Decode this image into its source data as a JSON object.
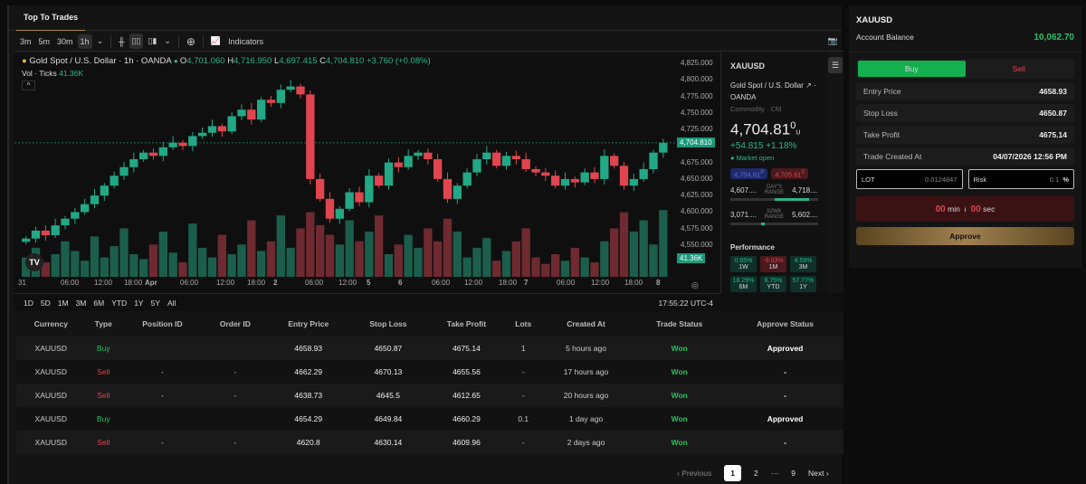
{
  "tab": "Top To Trades",
  "toolbar": {
    "intervals": [
      "3m",
      "5m",
      "30m",
      "1h"
    ],
    "indicators": "Indicators"
  },
  "symbol_line": {
    "title": "Gold Spot / U.S. Dollar · 1h · OANDA",
    "o": "4,701.060",
    "h": "4,716.950",
    "l": "4,697.415",
    "c": "4,704.810",
    "chg": "+3.760 (+0.08%)",
    "vol_label": "Vol · Ticks",
    "vol_value": "41.36K"
  },
  "price_axis": [
    "4,825.000",
    "4,800.000",
    "4,775.000",
    "4,750.000",
    "4,725.000",
    "4,675.000",
    "4,650.000",
    "4,625.000",
    "4,600.000",
    "4,575.000",
    "4,550.000"
  ],
  "last_price_tag": "4,704.810",
  "vol_tag": "41.36K",
  "time_axis": [
    "31",
    "06:00",
    "12:00",
    "18:00",
    "Apr",
    "06:00",
    "12:00",
    "18:00",
    "2",
    "06:00",
    "12:00",
    "5",
    "6",
    "06:00",
    "12:00",
    "18:00",
    "7",
    "06:00",
    "12:00",
    "18:00",
    "8"
  ],
  "ranges": [
    "1D",
    "5D",
    "1M",
    "3M",
    "6M",
    "YTD",
    "1Y",
    "5Y",
    "All"
  ],
  "clock": "17:55:22 UTC-4",
  "chart_data": {
    "type": "candlestick",
    "ylim": [
      4535,
      4835
    ],
    "closes": [
      4560,
      4572,
      4565,
      4580,
      4590,
      4600,
      4612,
      4625,
      4640,
      4655,
      4668,
      4680,
      4690,
      4685,
      4698,
      4705,
      4700,
      4715,
      4720,
      4730,
      4722,
      4745,
      4755,
      4740,
      4770,
      4765,
      4785,
      4790,
      4778,
      4650,
      4620,
      4590,
      4605,
      4630,
      4615,
      4655,
      4640,
      4675,
      4668,
      4685,
      4690,
      4680,
      4650,
      4620,
      4640,
      4660,
      4680,
      4690,
      4670,
      4685,
      4680,
      4665,
      4660,
      4655,
      4640,
      4650,
      4645,
      4660,
      4650,
      4685,
      4670,
      4640,
      4650,
      4665,
      4690,
      4704.81
    ],
    "volumes": [
      12,
      18,
      9,
      14,
      22,
      16,
      10,
      25,
      12,
      19,
      30,
      14,
      11,
      20,
      28,
      15,
      9,
      33,
      18,
      12,
      26,
      14,
      20,
      35,
      16,
      22,
      38,
      18,
      30,
      40,
      32,
      26,
      20,
      35,
      22,
      28,
      38,
      14,
      20,
      26,
      18,
      30,
      22,
      36,
      28,
      12,
      18,
      24,
      10,
      16,
      22,
      30,
      12,
      8,
      14,
      10,
      18,
      12,
      9,
      22,
      30,
      40,
      28,
      35,
      20,
      41.36
    ],
    "up_color": "#22a884",
    "down_color": "#e0454f"
  },
  "info": {
    "ticker": "XAUUSD",
    "name": "Gold Spot / U.S. Dollar",
    "exchange": "OANDA",
    "type": "Commodity · Cfd",
    "price": "4,704.81",
    "price_sup": "0",
    "currency": "U",
    "change": "+54.815",
    "change_pct": "+1.18%",
    "status": "Market open",
    "bid": "4,704.81",
    "bid_sup": "P",
    "ask": "4,705.61",
    "ask_sup": "0",
    "day_low": "4,607....",
    "day_high": "4,718....",
    "day_label": "DAY'S RANGE",
    "wk_low": "3,071....",
    "wk_high": "5,602....",
    "wk_label": "52WK RANGE",
    "day_fill": 0.4,
    "wk_pos": 0.35,
    "performance": "Performance",
    "perf": [
      {
        "v": "0.65%",
        "p": "1W",
        "up": true
      },
      {
        "v": "-9.03%",
        "p": "1M",
        "up": false
      },
      {
        "v": "4.59%",
        "p": "3M",
        "up": true
      },
      {
        "v": "18.29%",
        "p": "6M",
        "up": true
      },
      {
        "v": "8.75%",
        "p": "YTD",
        "up": true
      },
      {
        "v": "57.77%",
        "p": "1Y",
        "up": true
      }
    ]
  },
  "table": {
    "headers": [
      "Currency",
      "Type",
      "Position ID",
      "Order ID",
      "Entry Price",
      "Stop Loss",
      "Take Profit",
      "Lots",
      "Created At",
      "Trade Status",
      "Approve Status"
    ],
    "rows": [
      [
        "XAUUSD",
        "Buy",
        "",
        "",
        "4658.93",
        "4650.87",
        "4675.14",
        "1",
        "5 hours ago",
        "Won",
        "Approved"
      ],
      [
        "XAUUSD",
        "Sell",
        "-",
        "-",
        "4662.29",
        "4670.13",
        "4655.56",
        "-",
        "17 hours ago",
        "Won",
        "-"
      ],
      [
        "XAUUSD",
        "Sell",
        "-",
        "-",
        "4638.73",
        "4645.5",
        "4612.65",
        "-",
        "20 hours ago",
        "Won",
        "-"
      ],
      [
        "XAUUSD",
        "Buy",
        "",
        "",
        "4654.29",
        "4649.84",
        "4660.29",
        "0.1",
        "1 day ago",
        "Won",
        "Approved"
      ],
      [
        "XAUUSD",
        "Sell",
        "-",
        "-",
        "4620.8",
        "4630.14",
        "4609.96",
        "-",
        "2 days ago",
        "Won",
        "-"
      ]
    ]
  },
  "pagination": {
    "prev": "Previous",
    "pages": [
      "1",
      "2",
      "···",
      "9"
    ],
    "next": "Next"
  },
  "panel": {
    "ticker": "XAUUSD",
    "balance_label": "Account Balance",
    "balance": "10,062.70",
    "buy": "Buy",
    "sell": "Sell",
    "fields": [
      {
        "label": "Entry Price",
        "value": "4658.93"
      },
      {
        "label": "Stop Loss",
        "value": "4650.87"
      },
      {
        "label": "Take Profit",
        "value": "4675.14"
      },
      {
        "label": "Trade Created At",
        "value": "04/07/2026 12:56 PM"
      }
    ],
    "lot_label": "LOT",
    "lot_value": "0.0124847",
    "risk_label": "Risk",
    "risk_value": "0.1",
    "risk_unit": "%",
    "timer_min": "00",
    "min": "min",
    "timer_sec": "00",
    "sec": "sec",
    "approve": "Approve"
  }
}
